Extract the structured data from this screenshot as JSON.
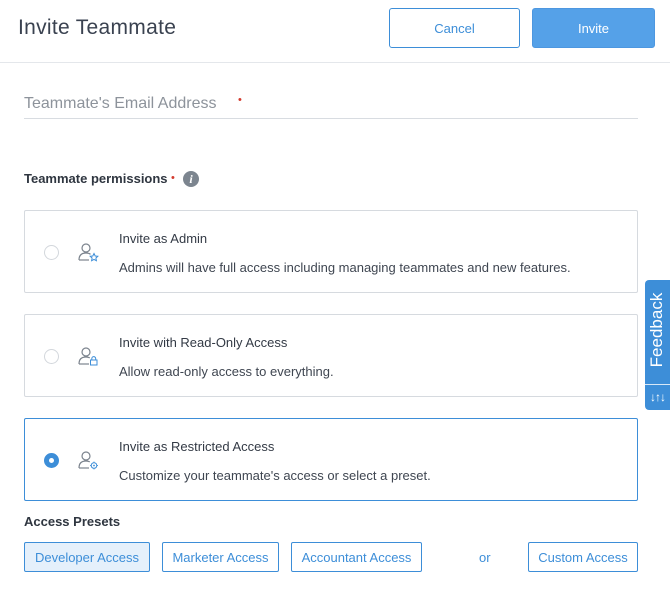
{
  "header": {
    "title": "Invite Teammate",
    "cancel_label": "Cancel",
    "invite_label": "Invite"
  },
  "email": {
    "placeholder": "Teammate's Email Address",
    "value": "",
    "required_mark": "•"
  },
  "permissions": {
    "label": "Teammate permissions",
    "required_mark": "•",
    "info_icon": "info-icon",
    "options": [
      {
        "title": "Invite as Admin",
        "description": "Admins will have full access including managing teammates and new features.",
        "icon": "user-star-icon",
        "selected": false
      },
      {
        "title": "Invite with Read-Only Access",
        "description": "Allow read-only access to everything.",
        "icon": "user-lock-icon",
        "selected": false
      },
      {
        "title": "Invite as Restricted Access",
        "description": "Customize your teammate's access or select a preset.",
        "icon": "user-gear-icon",
        "selected": true
      }
    ]
  },
  "presets": {
    "label": "Access Presets",
    "items": [
      "Developer Access",
      "Marketer Access",
      "Accountant Access"
    ],
    "active": "Developer Access",
    "or_text": "or",
    "custom_label": "Custom Access"
  },
  "feedback": {
    "label": "Feedback",
    "glyph": "↓↑↓"
  },
  "colors": {
    "accent": "#3d8ed8",
    "primary_button": "#55a1e8",
    "required": "#d33a2e",
    "border": "#d6dadf"
  }
}
